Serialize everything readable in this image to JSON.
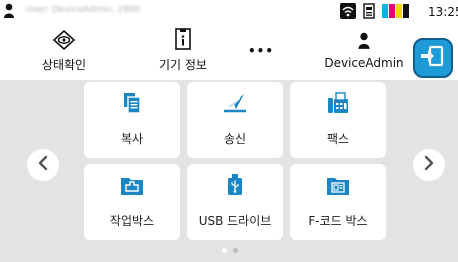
{
  "status": {
    "user_text": "User: DeviceAdmin, 2800",
    "clock": "13:25",
    "toner_colors": [
      "#00b5e6",
      "#e6007e",
      "#f5d800",
      "#111111"
    ]
  },
  "header": {
    "status_check_label": "상태확인",
    "device_info_label": "기기 정보",
    "more_label": "•••",
    "user_label": "DeviceAdmin"
  },
  "tiles": [
    {
      "label": "복사",
      "icon": "copy-icon"
    },
    {
      "label": "송신",
      "icon": "send-icon"
    },
    {
      "label": "팩스",
      "icon": "fax-icon"
    },
    {
      "label": "작업박스",
      "icon": "job-box-icon"
    },
    {
      "label": "USB 드라이브",
      "icon": "usb-drive-icon"
    },
    {
      "label": "F-코드 박스",
      "icon": "fcode-box-icon"
    }
  ],
  "pagination": {
    "current_page": 1,
    "total_pages": 2
  },
  "colors": {
    "accent": "#1e9ad6",
    "icon": "#1a87c4",
    "background": "#e3e3e3"
  }
}
